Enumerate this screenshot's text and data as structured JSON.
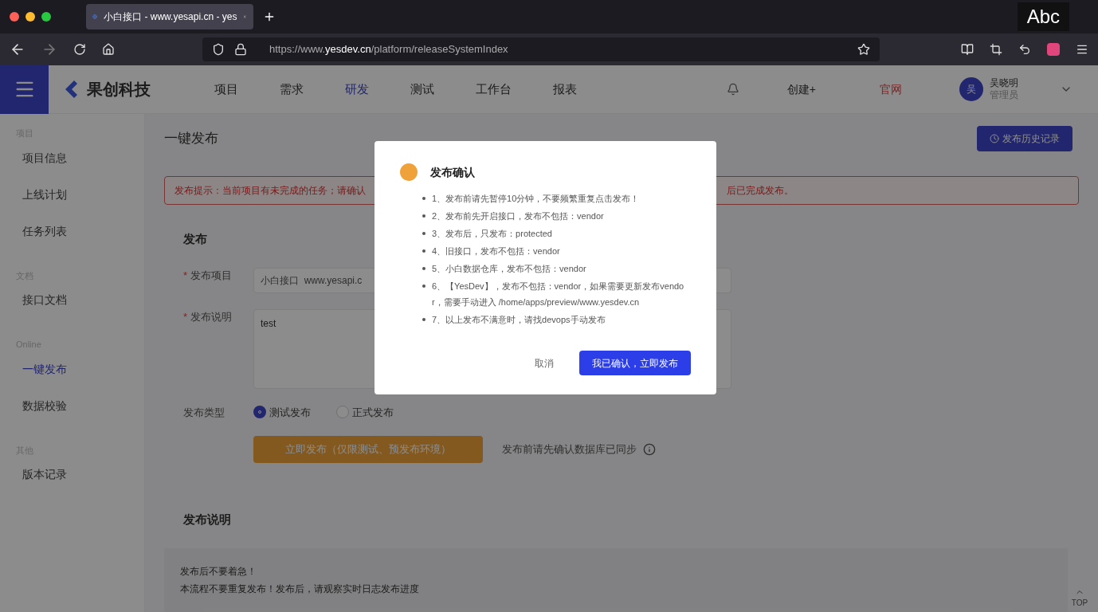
{
  "browser": {
    "tab_title": "小白接口 - www.yesapi.cn - yes",
    "url_prefix": "https://www.",
    "url_host": "yesdev.cn",
    "url_path": "/platform/releaseSystemIndex",
    "ime_indicator": "Abc"
  },
  "header": {
    "logo_text": "果创科技",
    "nav": [
      {
        "label": "项目",
        "selected": false
      },
      {
        "label": "需求",
        "selected": false
      },
      {
        "label": "研发",
        "selected": true
      },
      {
        "label": "测试",
        "selected": false
      },
      {
        "label": "工作台",
        "selected": false
      },
      {
        "label": "报表",
        "selected": false
      }
    ],
    "create_label": "创建+",
    "site_link": "官网",
    "user": {
      "avatar_text": "吴",
      "name": "吴晓明",
      "role": "管理员"
    }
  },
  "sidebar": {
    "groups": [
      {
        "label": "项目",
        "items": [
          {
            "label": "项目信息",
            "selected": false
          },
          {
            "label": "上线计划",
            "selected": false
          },
          {
            "label": "任务列表",
            "selected": false
          }
        ]
      },
      {
        "label": "文档",
        "items": [
          {
            "label": "接口文档",
            "selected": false
          }
        ]
      },
      {
        "label": "Online",
        "items": [
          {
            "label": "一键发布",
            "selected": true
          },
          {
            "label": "数据校验",
            "selected": false
          }
        ]
      },
      {
        "label": "其他",
        "items": [
          {
            "label": "版本记录",
            "selected": false
          }
        ]
      }
    ]
  },
  "page": {
    "title": "一键发布",
    "history_button": "发布历史记录",
    "alert": {
      "start": "发布提示：当前项目有未完成的任务；请确认",
      "end": "后已完成发布。"
    },
    "section_title": "发布",
    "fields": [
      {
        "label": "发布项目",
        "required": true,
        "required_mark": "*",
        "kind": "input",
        "value": "小白接口  www.yesapi.c"
      },
      {
        "label": "发布说明",
        "required": true,
        "required_mark": "*",
        "kind": "textarea",
        "value": "test"
      }
    ],
    "type_label": "发布类型",
    "types": [
      {
        "label": "测试发布",
        "selected": true
      },
      {
        "label": "正式发布",
        "selected": false
      }
    ],
    "submit_button": "立即发布（仅限测试、预发布环境）",
    "hint": "发布前请先确认数据库已同步",
    "notes_title": "发布说明",
    "notes": [
      "发布后不要着急！",
      "本流程不要重复发布！发布后，请观察实时日志发布进度"
    ],
    "back_to_top": "TOP"
  },
  "modal": {
    "title": "发布确认",
    "items": [
      "1、发布前请先暂停10分钟，不要频繁重复点击发布！",
      "2、发布前先开启接口，发布不包括：vendor",
      "3、发布后，只发布：protected",
      "4、旧接口，发布不包括：vendor",
      "5、小白数据仓库，发布不包括：vendor",
      "6、【YesDev】，发布不包括：vendor，如果需要更新发布vendor，需要手动进入 /home/apps/preview/www.yesdev.cn",
      "7、以上发布不满意时，请找devops手动发布"
    ],
    "cancel_button": "取消",
    "confirm_button": "我已确认，立即发布"
  }
}
